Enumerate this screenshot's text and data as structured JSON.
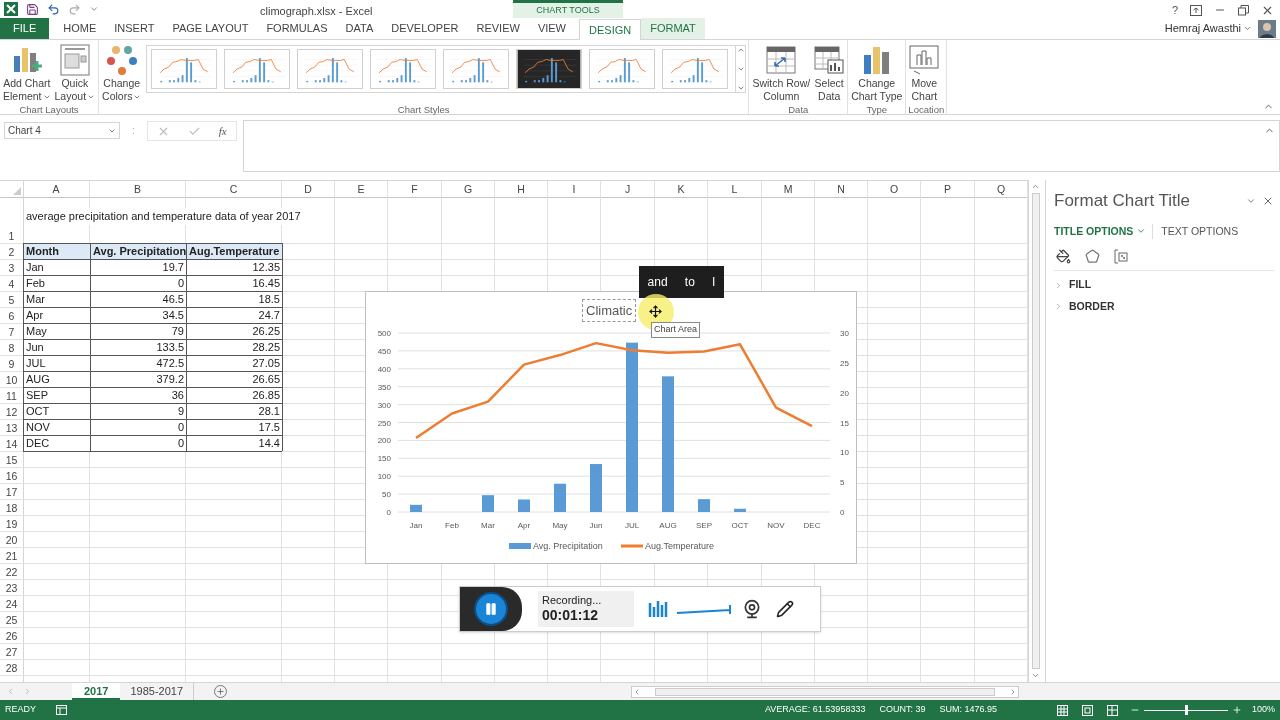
{
  "title_bar": {
    "title": "climograph.xlsx - Excel",
    "context_label": "CHART TOOLS",
    "help": "?",
    "user": "Hemraj Awasthi"
  },
  "tabs": [
    {
      "label": "FILE",
      "kind": "file",
      "selected": false
    },
    {
      "label": "HOME",
      "kind": "normal",
      "selected": false
    },
    {
      "label": "INSERT",
      "kind": "normal",
      "selected": false
    },
    {
      "label": "PAGE LAYOUT",
      "kind": "normal",
      "selected": false
    },
    {
      "label": "FORMULAS",
      "kind": "normal",
      "selected": false
    },
    {
      "label": "DATA",
      "kind": "normal",
      "selected": false
    },
    {
      "label": "DEVELOPER",
      "kind": "normal",
      "selected": false
    },
    {
      "label": "REVIEW",
      "kind": "normal",
      "selected": false
    },
    {
      "label": "VIEW",
      "kind": "normal",
      "selected": false
    },
    {
      "label": "DESIGN",
      "kind": "context",
      "selected": true
    },
    {
      "label": "FORMAT",
      "kind": "context",
      "selected": false
    }
  ],
  "ribbon": {
    "groups": [
      {
        "label": "Chart Layouts",
        "buttons": [
          {
            "lines": [
              "Add Chart",
              "Element"
            ],
            "dropdown": true
          },
          {
            "lines": [
              "Quick",
              "Layout"
            ],
            "dropdown": true
          }
        ]
      },
      {
        "label": "Chart Styles",
        "buttons": [
          {
            "lines": [
              "Change",
              "Colors"
            ],
            "dropdown": true
          }
        ],
        "styles": [
          {
            "dark": false
          },
          {
            "dark": false
          },
          {
            "dark": false
          },
          {
            "dark": false
          },
          {
            "dark": false
          },
          {
            "dark": true
          },
          {
            "dark": false
          },
          {
            "dark": false
          }
        ]
      },
      {
        "label": "Data",
        "buttons": [
          {
            "lines": [
              "Switch Row/",
              "Column"
            ],
            "dropdown": false
          },
          {
            "lines": [
              "Select",
              "Data"
            ],
            "dropdown": false
          }
        ]
      },
      {
        "label": "Type",
        "buttons": [
          {
            "lines": [
              "Change",
              "Chart Type"
            ],
            "dropdown": false
          }
        ]
      },
      {
        "label": "Location",
        "buttons": [
          {
            "lines": [
              "Move",
              "Chart"
            ],
            "dropdown": false
          }
        ]
      }
    ]
  },
  "formula_bar": {
    "name_box": "Chart 4",
    "separator": ":",
    "fx": "fx"
  },
  "sheet": {
    "columns": [
      "A",
      "B",
      "C",
      "D",
      "E",
      "F",
      "G",
      "H",
      "I",
      "J",
      "K",
      "L",
      "M",
      "N",
      "O",
      "P",
      "Q"
    ],
    "rows": [
      {
        "header": "1",
        "kind": "note",
        "cells": [
          "average precipitation and temperature data of year 2017"
        ]
      },
      {
        "header": "2",
        "kind": "table_header",
        "cells": [
          "Month",
          "Avg. Precipitation",
          "Aug.Temperature"
        ]
      },
      {
        "header": "3",
        "kind": "data",
        "cells": [
          "Jan",
          "19.7",
          "12.35"
        ]
      },
      {
        "header": "4",
        "kind": "data",
        "cells": [
          "Feb",
          "0",
          "16.45"
        ]
      },
      {
        "header": "5",
        "kind": "data",
        "cells": [
          "Mar",
          "46.5",
          "18.5"
        ]
      },
      {
        "header": "6",
        "kind": "data",
        "cells": [
          "Apr",
          "34.5",
          "24.7"
        ]
      },
      {
        "header": "7",
        "kind": "data",
        "cells": [
          "May",
          "79",
          "26.25"
        ]
      },
      {
        "header": "8",
        "kind": "data",
        "cells": [
          "Jun",
          "133.5",
          "28.25"
        ]
      },
      {
        "header": "9",
        "kind": "data",
        "cells": [
          "JUL",
          "472.5",
          "27.05"
        ]
      },
      {
        "header": "10",
        "kind": "data",
        "cells": [
          "AUG",
          "379.2",
          "26.65"
        ]
      },
      {
        "header": "11",
        "kind": "data",
        "cells": [
          "SEP",
          "36",
          "26.85"
        ]
      },
      {
        "header": "12",
        "kind": "data",
        "cells": [
          "OCT",
          "9",
          "28.1"
        ]
      },
      {
        "header": "13",
        "kind": "data",
        "cells": [
          "NOV",
          "0",
          "17.5"
        ]
      },
      {
        "header": "14",
        "kind": "data",
        "cells": [
          "DEC",
          "0",
          "14.4"
        ]
      },
      {
        "header": "15",
        "kind": "empty"
      },
      {
        "header": "16",
        "kind": "empty"
      },
      {
        "header": "17",
        "kind": "empty"
      },
      {
        "header": "18",
        "kind": "empty"
      },
      {
        "header": "19",
        "kind": "empty"
      },
      {
        "header": "20",
        "kind": "empty"
      },
      {
        "header": "21",
        "kind": "empty"
      },
      {
        "header": "22",
        "kind": "empty"
      },
      {
        "header": "23",
        "kind": "empty"
      },
      {
        "header": "24",
        "kind": "empty"
      },
      {
        "header": "25",
        "kind": "empty"
      },
      {
        "header": "26",
        "kind": "empty"
      },
      {
        "header": "27",
        "kind": "empty"
      },
      {
        "header": "28",
        "kind": "empty"
      }
    ]
  },
  "chart": {
    "bars": {
      "chart_data": {
        "type": "bar",
        "grid": true,
        "title": "Climatic",
        "categories": [
          "Jan",
          "Feb",
          "Mar",
          "Apr",
          "May",
          "Jun",
          "JUL",
          "AUG",
          "SEP",
          "OCT",
          "NOV",
          "DEC"
        ],
        "series": [
          {
            "name": "Avg. Precipitation",
            "color": "#5b9bd5",
            "values": [
              20,
              0,
              47,
              35,
              79,
              134,
              473,
              379,
              36,
              9,
              0,
              0
            ]
          }
        ],
        "ylim": [
          0,
          500
        ],
        "yticks": [
          0,
          50,
          100,
          150,
          200,
          250,
          300,
          350,
          400,
          450,
          500
        ]
      }
    },
    "line": {
      "chart_data": {
        "type": "line",
        "series": [
          {
            "name": "Aug.Temperature",
            "color": "#ed7d31",
            "values": [
              12.4,
              16.5,
              18.5,
              24.7,
              26.3,
              28.3,
              27.1,
              26.7,
              26.9,
              28.1,
              17.5,
              14.4
            ]
          }
        ],
        "ylim": [
          0,
          30
        ],
        "yticks": [
          0,
          5,
          10,
          15,
          20,
          25,
          30
        ]
      }
    }
  },
  "overlay": {
    "tooltip": "Chart Area",
    "caption_words": [
      "and",
      "to",
      "I"
    ]
  },
  "recorder": {
    "status": "Recording...",
    "time": "00:01:12"
  },
  "pane": {
    "title": "Format Chart Title",
    "tabs": [
      {
        "label": "TITLE OPTIONS",
        "selected": true
      },
      {
        "label": "TEXT OPTIONS",
        "selected": false
      }
    ],
    "sections": [
      {
        "label": "FILL",
        "expanded": false
      },
      {
        "label": "BORDER",
        "expanded": false
      }
    ]
  },
  "sheet_tabs": [
    {
      "label": "2017",
      "selected": true
    },
    {
      "label": "1985-2017",
      "selected": false
    }
  ],
  "status_bar": {
    "mode": "READY",
    "average": "AVERAGE: 61.53958333",
    "count": "COUNT: 39",
    "sum": "SUM: 1476.95",
    "zoom": "100%",
    "zoom_slider": {
      "level": 0.5
    }
  }
}
